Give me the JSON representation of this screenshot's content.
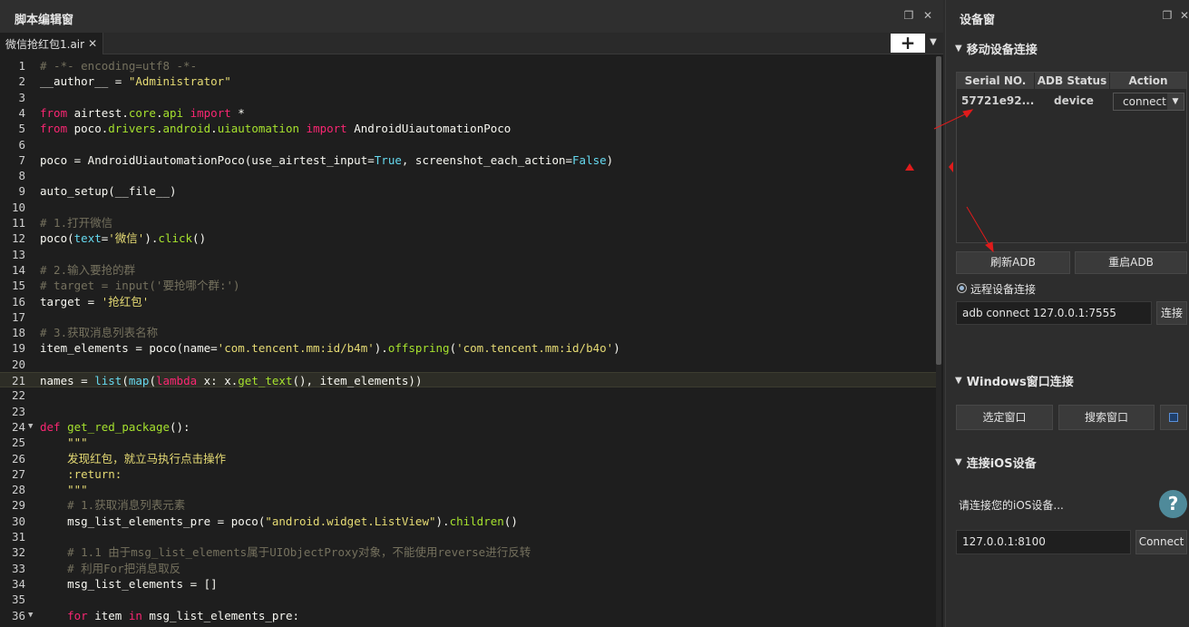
{
  "editor": {
    "title": "脚本编辑窗",
    "tab_label": "微信抢红包1.air",
    "tab_close": "✕",
    "add_label": "+",
    "lines": [
      {
        "n": "1",
        "fold": "",
        "segs": [
          [
            "c",
            "# -*- encoding=utf8 -*-"
          ]
        ]
      },
      {
        "n": "2",
        "fold": "",
        "segs": [
          [
            "p",
            "__author__ = "
          ],
          [
            "s",
            "\"Administrator\""
          ]
        ]
      },
      {
        "n": "3",
        "fold": "",
        "segs": []
      },
      {
        "n": "4",
        "fold": "",
        "segs": [
          [
            "k",
            "from"
          ],
          [
            "p",
            " airtest."
          ],
          [
            "f",
            "core"
          ],
          [
            "p",
            "."
          ],
          [
            "f",
            "api"
          ],
          [
            "p",
            " "
          ],
          [
            "k",
            "import"
          ],
          [
            "p",
            " *"
          ]
        ]
      },
      {
        "n": "5",
        "fold": "",
        "segs": [
          [
            "k",
            "from"
          ],
          [
            "p",
            " poco."
          ],
          [
            "f",
            "drivers"
          ],
          [
            "p",
            "."
          ],
          [
            "f",
            "android"
          ],
          [
            "p",
            "."
          ],
          [
            "f",
            "uiautomation"
          ],
          [
            "p",
            " "
          ],
          [
            "k",
            "import"
          ],
          [
            "p",
            " AndroidUiautomationPoco"
          ]
        ]
      },
      {
        "n": "6",
        "fold": "",
        "segs": []
      },
      {
        "n": "7",
        "fold": "",
        "segs": [
          [
            "p",
            "poco = AndroidUiautomationPoco(use_airtest_input="
          ],
          [
            "b",
            "True"
          ],
          [
            "p",
            ", screenshot_each_action="
          ],
          [
            "b",
            "False"
          ],
          [
            "p",
            ")"
          ]
        ]
      },
      {
        "n": "8",
        "fold": "",
        "segs": []
      },
      {
        "n": "9",
        "fold": "",
        "segs": [
          [
            "p",
            "auto_setup(__file__)"
          ]
        ]
      },
      {
        "n": "10",
        "fold": "",
        "segs": []
      },
      {
        "n": "11",
        "fold": "",
        "segs": [
          [
            "c",
            "# 1.打开微信"
          ]
        ]
      },
      {
        "n": "12",
        "fold": "",
        "segs": [
          [
            "p",
            "poco("
          ],
          [
            "b",
            "text"
          ],
          [
            "p",
            "="
          ],
          [
            "s",
            "'微信'"
          ],
          [
            "p",
            ")."
          ],
          [
            "f",
            "click"
          ],
          [
            "p",
            "()"
          ]
        ]
      },
      {
        "n": "13",
        "fold": "",
        "segs": []
      },
      {
        "n": "14",
        "fold": "",
        "segs": [
          [
            "c",
            "# 2.输入要抢的群"
          ]
        ]
      },
      {
        "n": "15",
        "fold": "",
        "segs": [
          [
            "c",
            "# target = input('要抢哪个群:')"
          ]
        ]
      },
      {
        "n": "16",
        "fold": "",
        "segs": [
          [
            "p",
            "target = "
          ],
          [
            "s",
            "'抢红包'"
          ]
        ]
      },
      {
        "n": "17",
        "fold": "",
        "segs": []
      },
      {
        "n": "18",
        "fold": "",
        "segs": [
          [
            "c",
            "# 3.获取消息列表名称"
          ]
        ]
      },
      {
        "n": "19",
        "fold": "",
        "segs": [
          [
            "p",
            "item_elements = poco(name="
          ],
          [
            "s",
            "'com.tencent.mm:id/b4m'"
          ],
          [
            "p",
            ")."
          ],
          [
            "f",
            "offspring"
          ],
          [
            "p",
            "("
          ],
          [
            "s",
            "'com.tencent.mm:id/b4o'"
          ],
          [
            "p",
            ")"
          ]
        ]
      },
      {
        "n": "20",
        "fold": "",
        "segs": []
      },
      {
        "n": "21",
        "fold": "",
        "cur": true,
        "segs": [
          [
            "p",
            "names = "
          ],
          [
            "b",
            "list"
          ],
          [
            "p",
            "("
          ],
          [
            "b",
            "map"
          ],
          [
            "p",
            "("
          ],
          [
            "k",
            "lambda"
          ],
          [
            "p",
            " x: x."
          ],
          [
            "f",
            "get_text"
          ],
          [
            "p",
            "(), item_elements))"
          ]
        ]
      },
      {
        "n": "22",
        "fold": "",
        "segs": []
      },
      {
        "n": "23",
        "fold": "",
        "segs": []
      },
      {
        "n": "24",
        "fold": "▼",
        "segs": [
          [
            "k",
            "def"
          ],
          [
            "p",
            " "
          ],
          [
            "f",
            "get_red_package"
          ],
          [
            "p",
            "():"
          ]
        ]
      },
      {
        "n": "25",
        "fold": "",
        "segs": [
          [
            "p",
            "    "
          ],
          [
            "s",
            "\"\"\""
          ]
        ]
      },
      {
        "n": "26",
        "fold": "",
        "segs": [
          [
            "p",
            "    "
          ],
          [
            "s",
            "发现红包，就立马执行点击操作"
          ]
        ]
      },
      {
        "n": "27",
        "fold": "",
        "segs": [
          [
            "p",
            "    "
          ],
          [
            "s",
            ":return:"
          ]
        ]
      },
      {
        "n": "28",
        "fold": "",
        "segs": [
          [
            "p",
            "    "
          ],
          [
            "s",
            "\"\"\""
          ]
        ]
      },
      {
        "n": "29",
        "fold": "",
        "segs": [
          [
            "p",
            "    "
          ],
          [
            "c",
            "# 1.获取消息列表元素"
          ]
        ]
      },
      {
        "n": "30",
        "fold": "",
        "segs": [
          [
            "p",
            "    msg_list_elements_pre = poco("
          ],
          [
            "s",
            "\"android.widget.ListView\""
          ],
          [
            "p",
            ")."
          ],
          [
            "f",
            "children"
          ],
          [
            "p",
            "()"
          ]
        ]
      },
      {
        "n": "31",
        "fold": "",
        "segs": []
      },
      {
        "n": "32",
        "fold": "",
        "segs": [
          [
            "p",
            "    "
          ],
          [
            "c",
            "# 1.1 由于msg_list_elements属于UIObjectProxy对象，不能使用reverse进行反转"
          ]
        ]
      },
      {
        "n": "33",
        "fold": "",
        "segs": [
          [
            "p",
            "    "
          ],
          [
            "c",
            "# 利用For把消息取反"
          ]
        ]
      },
      {
        "n": "34",
        "fold": "",
        "segs": [
          [
            "p",
            "    msg_list_elements = []"
          ]
        ]
      },
      {
        "n": "35",
        "fold": "",
        "segs": []
      },
      {
        "n": "36",
        "fold": "▼",
        "segs": [
          [
            "p",
            "    "
          ],
          [
            "k",
            "for"
          ],
          [
            "p",
            " item "
          ],
          [
            "k",
            "in"
          ],
          [
            "p",
            " msg_list_elements_pre:"
          ]
        ]
      }
    ]
  },
  "device": {
    "title": "设备窗",
    "mobile_section": "移动设备连接",
    "columns": [
      "Serial NO.",
      "ADB Status",
      "Action"
    ],
    "row": {
      "serial": "57721e92...",
      "status": "device",
      "action": "connect"
    },
    "refresh_adb": "刷新ADB",
    "restart_adb": "重启ADB",
    "remote_label": "远程设备连接",
    "remote_value": "adb connect 127.0.0.1:7555",
    "remote_connect": "连接",
    "windows_section": "Windows窗口连接",
    "select_window": "选定窗口",
    "search_window": "搜索窗口",
    "ios_section": "连接iOS设备",
    "ios_hint": "请连接您的iOS设备...",
    "ios_address": "127.0.0.1:8100",
    "ios_connect": "Connect",
    "help": "?"
  },
  "colors": {
    "accent_arrow": "#e01b1b",
    "help_button": "#4f8a9a"
  }
}
